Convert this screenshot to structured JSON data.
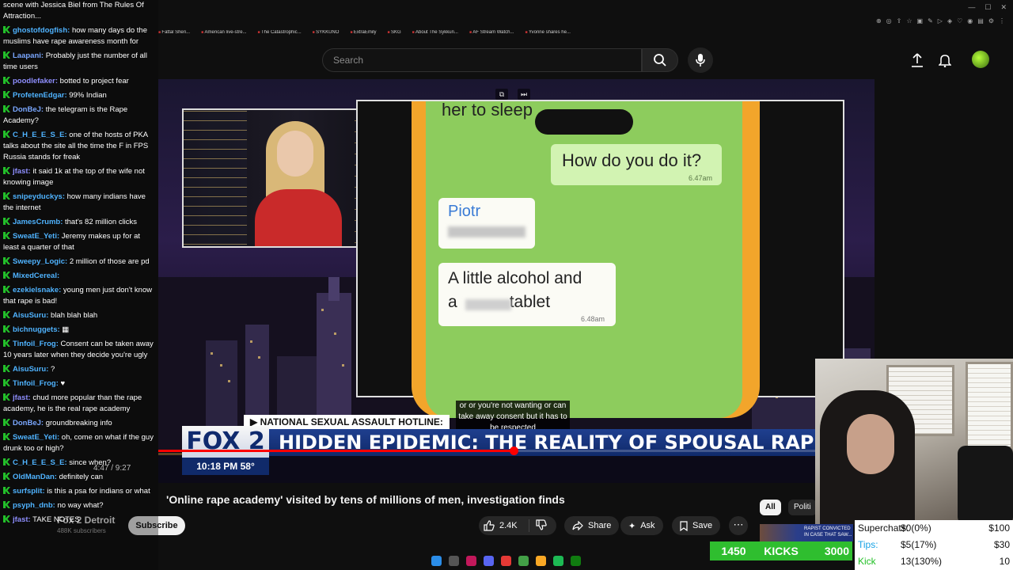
{
  "browser": {
    "bookmarks": [
      "Fattal Sheri...",
      "American live-stre...",
      "The Catastrophic...",
      "SYKKUNO",
      "ExtraEmily",
      "SKG",
      "About The Sykkun...",
      "AF Stream Watch...",
      "Yvonne shares he..."
    ]
  },
  "header": {
    "search_placeholder": "Search"
  },
  "video": {
    "phone_top_text": "her to sleep",
    "bubble1_text": "How do you do it?",
    "bubble1_time": "6.47am",
    "bubble2_name": "Piotr",
    "bubble3_line1": "A little alcohol and",
    "bubble3_line2_start": "a",
    "bubble3_line2_end": "tablet",
    "bubble3_time": "6.48am",
    "hotline": "▶ NATIONAL SEXUAL ASSAULT HOTLINE:",
    "caption": "or or you're not wanting or can take away consent but it has to be respected",
    "logo": "FOX 2",
    "headline": "HIDDEN EPIDEMIC: THE REALITY OF SPOUSAL RAPE IN THE U.",
    "time_temp": "10:18 PM  58°",
    "time_overlay": "4:47 / 9:27",
    "progress": 0.51
  },
  "info": {
    "title": "'Online rape academy' visited by tens of millions of men, investigation finds",
    "channel": "Fox 2 Detroit",
    "subs": "488K subscribers",
    "subscribe": "Subscribe",
    "likes": "2.4K",
    "share": "Share",
    "ask": "Ask",
    "save": "Save",
    "chip_all": "All",
    "chip_politics": "Politi",
    "thumb_text": "RAPIST CONVICTED IN CASE THAT SAW..."
  },
  "chat": [
    {
      "user": "",
      "color": "#fff",
      "text": "scene with Jessica Biel from The Rules Of Attraction..."
    },
    {
      "user": "ghostofdogfish:",
      "color": "#4fb3ff",
      "text": "how many days do the muslims have rape awareness month for"
    },
    {
      "user": "Laapani:",
      "color": "#7aa7ff",
      "text": "Probably just the number of all time users"
    },
    {
      "user": "poodlefaker:",
      "color": "#8f8fff",
      "text": "botted to project fear"
    },
    {
      "user": "ProfetenEdgar:",
      "color": "#4fb3ff",
      "text": "99% Indian"
    },
    {
      "user": "DonBeJ:",
      "color": "#7aa7ff",
      "text": "the telegram is the Rape Academy?"
    },
    {
      "user": "C_H_E_E_S_E:",
      "color": "#4fb3ff",
      "text": "one of the hosts of PKA talks about the site all the time the F in FPS Russia stands for freak"
    },
    {
      "user": "jfast:",
      "color": "#8f8fff",
      "text": "it said 1k at the top of the wife not knowing image"
    },
    {
      "user": "snipeyduckys:",
      "color": "#4fb3ff",
      "text": "how many indians have the internet"
    },
    {
      "user": "JamesCrumb:",
      "color": "#4fb3ff",
      "text": "that's 82 million clicks"
    },
    {
      "user": "SweatE_Yeti:",
      "color": "#4fb3ff",
      "text": "Jeremy makes up for at least a quarter of that"
    },
    {
      "user": "Sweepy_Logic:",
      "color": "#4fb3ff",
      "text": "2 million of those are pd"
    },
    {
      "user": "MixedCereal:",
      "color": "#4fb3ff",
      "text": ""
    },
    {
      "user": "ezekielsnake:",
      "color": "#4fb3ff",
      "text": "young men just don't know that rape is bad!"
    },
    {
      "user": "AisuSuru:",
      "color": "#4fb3ff",
      "text": "blah blah blah"
    },
    {
      "user": "bichnuggets:",
      "color": "#4fb3ff",
      "text": "▦"
    },
    {
      "user": "Tinfoil_Frog:",
      "color": "#4fb3ff",
      "text": "Consent can be taken away 10 years later when they decide you're ugly"
    },
    {
      "user": "AisuSuru:",
      "color": "#4fb3ff",
      "text": "?"
    },
    {
      "user": "Tinfoil_Frog:",
      "color": "#4fb3ff",
      "text": "♥"
    },
    {
      "user": "jfast:",
      "color": "#8f8fff",
      "text": "chud more popular than the rape academy, he is the real rape academy"
    },
    {
      "user": "DonBeJ:",
      "color": "#7aa7ff",
      "text": "groundbreaking info"
    },
    {
      "user": "SweatE_Yeti:",
      "color": "#4fb3ff",
      "text": "oh, come on what if the guy drunk too or high?"
    },
    {
      "user": "C_H_E_E_S_E:",
      "color": "#4fb3ff",
      "text": "since when?"
    },
    {
      "user": "OldManDan:",
      "color": "#4fb3ff",
      "text": "definitely can"
    },
    {
      "user": "surfsplit:",
      "color": "#4fb3ff",
      "text": "is this a psa for indians or what"
    },
    {
      "user": "psyph_dnb:",
      "color": "#4fb3ff",
      "text": "no way what?"
    },
    {
      "user": "jfast:",
      "color": "#8f8fff",
      "text": "TAKE NOTES"
    }
  ],
  "stream": {
    "superchats_label": "Superchats:",
    "superchats_value": "$0(0%)",
    "superchats_goal": "$100",
    "tips_label": "Tips:",
    "tips_value": "$5(17%)",
    "tips_goal": "$30",
    "kicksubs_label": "Kick Subs:",
    "kicksubs_value": "13(130%)",
    "kicksubs_goal": "10",
    "kicks_count": "1450",
    "kicks_label": "KICKS",
    "kicks_goal": "3000"
  }
}
